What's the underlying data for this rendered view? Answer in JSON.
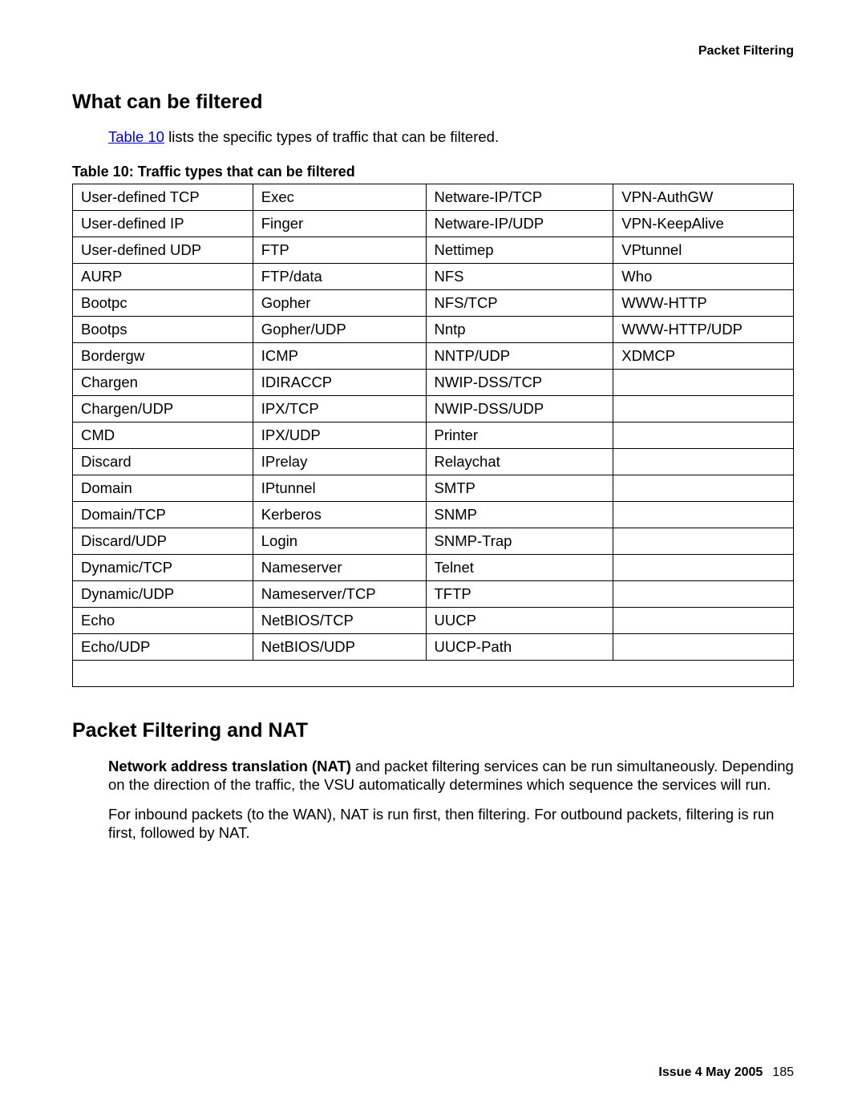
{
  "header": {
    "right": "Packet Filtering"
  },
  "section1": {
    "title": "What can be filtered",
    "intro_link": "Table 10",
    "intro_rest": " lists the specific types of traffic that can be filtered.",
    "table_caption": "Table 10: Traffic types that can be filtered"
  },
  "table": {
    "rows": [
      [
        "User-defined TCP",
        "Exec",
        "Netware-IP/TCP",
        "VPN-AuthGW"
      ],
      [
        "User-defined IP",
        "Finger",
        "Netware-IP/UDP",
        "VPN-KeepAlive"
      ],
      [
        "User-defined UDP",
        "FTP",
        "Nettimep",
        "VPtunnel"
      ],
      [
        "AURP",
        "FTP/data",
        "NFS",
        "Who"
      ],
      [
        "Bootpc",
        "Gopher",
        "NFS/TCP",
        "WWW-HTTP"
      ],
      [
        "Bootps",
        "Gopher/UDP",
        "Nntp",
        "WWW-HTTP/UDP"
      ],
      [
        "Bordergw",
        "ICMP",
        "NNTP/UDP",
        "XDMCP"
      ],
      [
        "Chargen",
        "IDIRACCP",
        "NWIP-DSS/TCP",
        ""
      ],
      [
        "Chargen/UDP",
        "IPX/TCP",
        "NWIP-DSS/UDP",
        ""
      ],
      [
        "CMD",
        "IPX/UDP",
        "Printer",
        ""
      ],
      [
        "Discard",
        "IPrelay",
        "Relaychat",
        ""
      ],
      [
        "Domain",
        "IPtunnel",
        "SMTP",
        ""
      ],
      [
        "Domain/TCP",
        "Kerberos",
        "SNMP",
        ""
      ],
      [
        "Discard/UDP",
        "Login",
        "SNMP-Trap",
        ""
      ],
      [
        "Dynamic/TCP",
        "Nameserver",
        "Telnet",
        ""
      ],
      [
        "Dynamic/UDP",
        "Nameserver/TCP",
        "TFTP",
        ""
      ],
      [
        "Echo",
        "NetBIOS/TCP",
        "UUCP",
        ""
      ],
      [
        "Echo/UDP",
        "NetBIOS/UDP",
        "UUCP-Path",
        ""
      ]
    ]
  },
  "section2": {
    "title": "Packet Filtering and NAT",
    "p1_bold": "Network address translation (NAT)",
    "p1_rest": " and packet filtering services can be run simultaneously. Depending on the direction of the traffic, the VSU automatically determines which sequence the services will run.",
    "p2": "For inbound packets (to the WAN), NAT is run first, then filtering. For outbound packets, filtering is run first, followed by NAT."
  },
  "footer": {
    "issue": "Issue 4   May 2005",
    "page": "185"
  }
}
